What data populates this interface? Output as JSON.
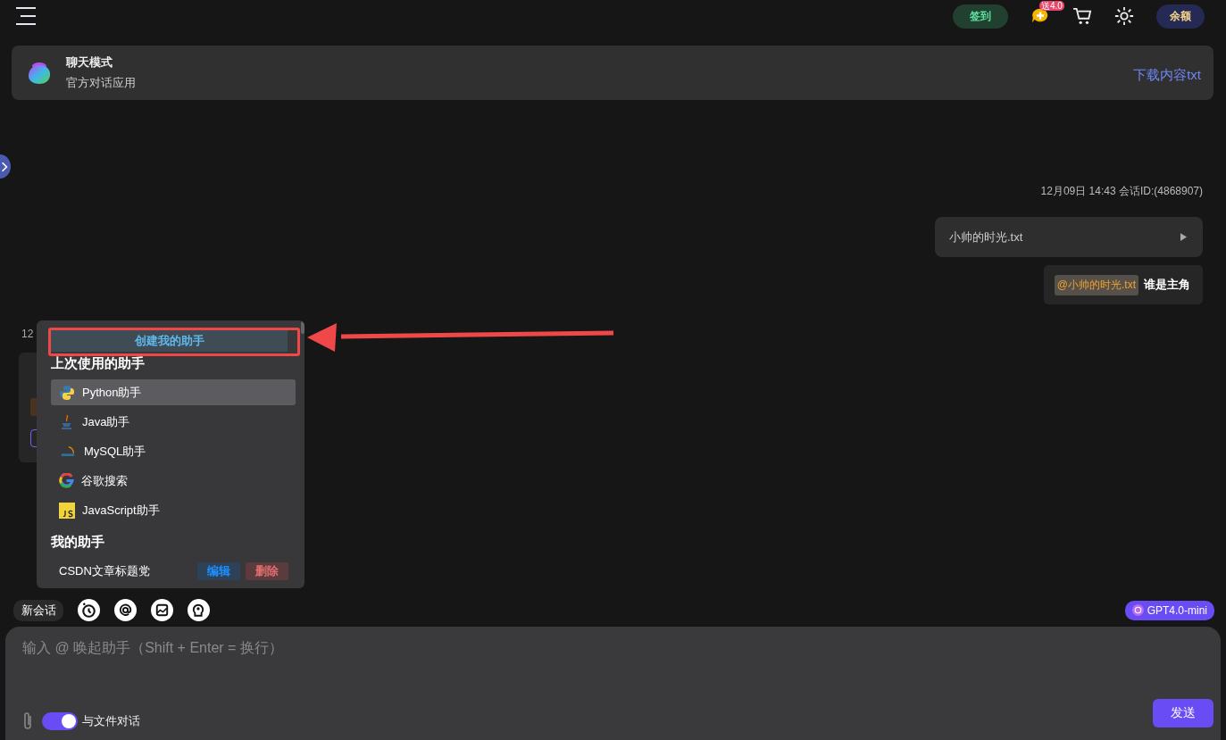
{
  "top_bar": {
    "checkin": "签到",
    "promo_badge": "送4.0",
    "balance": "余额"
  },
  "app_header": {
    "title": "聊天模式",
    "subtitle": "官方对话应用",
    "download_link": "下载内容txt"
  },
  "conversation": {
    "meta": "12月09日 14:43 会话ID:(4868907)",
    "file_card": {
      "name": "小帅的时光.txt"
    },
    "message": {
      "mention": "@小帅的时光.txt",
      "text": "谁是主角"
    },
    "reply": {
      "time": "12"
    }
  },
  "assistant_menu": {
    "create_button": "创建我的助手",
    "sections": [
      {
        "title": "上次使用的助手",
        "items": [
          {
            "label": "Python助手",
            "kind": "python",
            "selected": true
          },
          {
            "label": "Java助手",
            "kind": "java",
            "selected": false
          },
          {
            "label": "MySQL助手",
            "kind": "mysql",
            "selected": false
          },
          {
            "label": "谷歌搜索",
            "kind": "google",
            "selected": false
          },
          {
            "label": "JavaScript助手",
            "kind": "js",
            "selected": false
          }
        ]
      },
      {
        "title": "我的助手",
        "items": [
          {
            "label": "CSDN文章标题党",
            "actions": [
              "编辑",
              "删除"
            ],
            "selected": false
          }
        ]
      }
    ]
  },
  "toolbar": {
    "new_chat": "新会话",
    "model": "GPT4.0-mini"
  },
  "composer": {
    "placeholder": "输入 @ 唤起助手（Shift + Enter = 换行）",
    "file_chat": {
      "label": "与文件对话",
      "on": true
    },
    "send": "发送"
  }
}
